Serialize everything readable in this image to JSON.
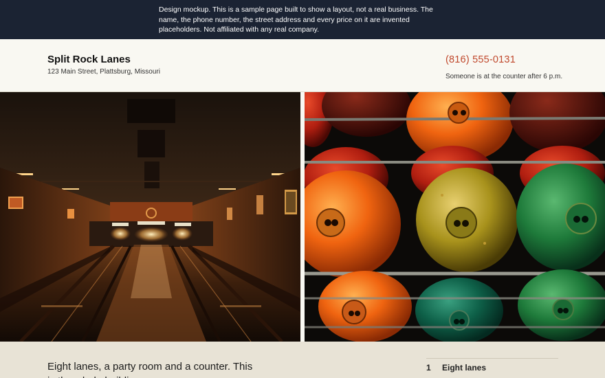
{
  "banner": {
    "text": "Design mockup. This is a sample page built to show a layout, not a real business. The name, the phone number, the street address and every price on it are invented placeholders. Not affiliated with any real company."
  },
  "header": {
    "name": "Split Rock Lanes",
    "address": "123 Main Street, Plattsburg, Missouri",
    "phone": "(816) 555-0131",
    "phone_note": "Someone is at the counter after 6 p.m."
  },
  "photos": {
    "left": "bowling-alley-lanes-photo",
    "right": "bowling-balls-rack-photo"
  },
  "intro": {
    "lead": "Eight lanes, a party room and a counter. This is the whole building."
  },
  "features": [
    {
      "num": "1",
      "label": "Eight lanes"
    }
  ],
  "colors": {
    "banner_bg": "#1b2333",
    "phone": "#c0482c",
    "page_bg": "#f9f8f2",
    "lower_bg": "#e8e3d6"
  }
}
